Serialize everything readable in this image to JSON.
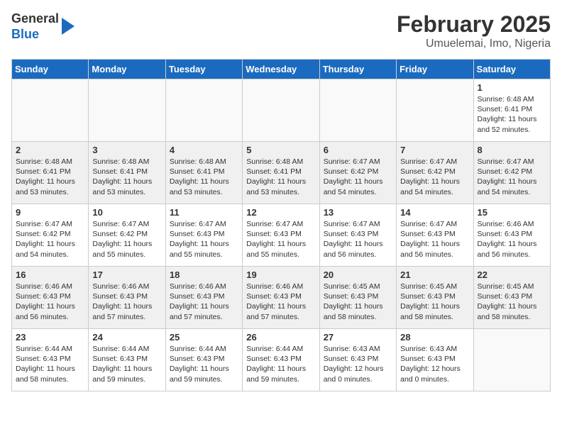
{
  "header": {
    "logo_general": "General",
    "logo_blue": "Blue",
    "title": "February 2025",
    "subtitle": "Umuelemai, Imo, Nigeria"
  },
  "days_of_week": [
    "Sunday",
    "Monday",
    "Tuesday",
    "Wednesday",
    "Thursday",
    "Friday",
    "Saturday"
  ],
  "weeks": [
    [
      {
        "day": "",
        "info": ""
      },
      {
        "day": "",
        "info": ""
      },
      {
        "day": "",
        "info": ""
      },
      {
        "day": "",
        "info": ""
      },
      {
        "day": "",
        "info": ""
      },
      {
        "day": "",
        "info": ""
      },
      {
        "day": "1",
        "info": "Sunrise: 6:48 AM\nSunset: 6:41 PM\nDaylight: 11 hours\nand 52 minutes."
      }
    ],
    [
      {
        "day": "2",
        "info": "Sunrise: 6:48 AM\nSunset: 6:41 PM\nDaylight: 11 hours\nand 53 minutes."
      },
      {
        "day": "3",
        "info": "Sunrise: 6:48 AM\nSunset: 6:41 PM\nDaylight: 11 hours\nand 53 minutes."
      },
      {
        "day": "4",
        "info": "Sunrise: 6:48 AM\nSunset: 6:41 PM\nDaylight: 11 hours\nand 53 minutes."
      },
      {
        "day": "5",
        "info": "Sunrise: 6:48 AM\nSunset: 6:41 PM\nDaylight: 11 hours\nand 53 minutes."
      },
      {
        "day": "6",
        "info": "Sunrise: 6:47 AM\nSunset: 6:42 PM\nDaylight: 11 hours\nand 54 minutes."
      },
      {
        "day": "7",
        "info": "Sunrise: 6:47 AM\nSunset: 6:42 PM\nDaylight: 11 hours\nand 54 minutes."
      },
      {
        "day": "8",
        "info": "Sunrise: 6:47 AM\nSunset: 6:42 PM\nDaylight: 11 hours\nand 54 minutes."
      }
    ],
    [
      {
        "day": "9",
        "info": "Sunrise: 6:47 AM\nSunset: 6:42 PM\nDaylight: 11 hours\nand 54 minutes."
      },
      {
        "day": "10",
        "info": "Sunrise: 6:47 AM\nSunset: 6:42 PM\nDaylight: 11 hours\nand 55 minutes."
      },
      {
        "day": "11",
        "info": "Sunrise: 6:47 AM\nSunset: 6:43 PM\nDaylight: 11 hours\nand 55 minutes."
      },
      {
        "day": "12",
        "info": "Sunrise: 6:47 AM\nSunset: 6:43 PM\nDaylight: 11 hours\nand 55 minutes."
      },
      {
        "day": "13",
        "info": "Sunrise: 6:47 AM\nSunset: 6:43 PM\nDaylight: 11 hours\nand 56 minutes."
      },
      {
        "day": "14",
        "info": "Sunrise: 6:47 AM\nSunset: 6:43 PM\nDaylight: 11 hours\nand 56 minutes."
      },
      {
        "day": "15",
        "info": "Sunrise: 6:46 AM\nSunset: 6:43 PM\nDaylight: 11 hours\nand 56 minutes."
      }
    ],
    [
      {
        "day": "16",
        "info": "Sunrise: 6:46 AM\nSunset: 6:43 PM\nDaylight: 11 hours\nand 56 minutes."
      },
      {
        "day": "17",
        "info": "Sunrise: 6:46 AM\nSunset: 6:43 PM\nDaylight: 11 hours\nand 57 minutes."
      },
      {
        "day": "18",
        "info": "Sunrise: 6:46 AM\nSunset: 6:43 PM\nDaylight: 11 hours\nand 57 minutes."
      },
      {
        "day": "19",
        "info": "Sunrise: 6:46 AM\nSunset: 6:43 PM\nDaylight: 11 hours\nand 57 minutes."
      },
      {
        "day": "20",
        "info": "Sunrise: 6:45 AM\nSunset: 6:43 PM\nDaylight: 11 hours\nand 58 minutes."
      },
      {
        "day": "21",
        "info": "Sunrise: 6:45 AM\nSunset: 6:43 PM\nDaylight: 11 hours\nand 58 minutes."
      },
      {
        "day": "22",
        "info": "Sunrise: 6:45 AM\nSunset: 6:43 PM\nDaylight: 11 hours\nand 58 minutes."
      }
    ],
    [
      {
        "day": "23",
        "info": "Sunrise: 6:44 AM\nSunset: 6:43 PM\nDaylight: 11 hours\nand 58 minutes."
      },
      {
        "day": "24",
        "info": "Sunrise: 6:44 AM\nSunset: 6:43 PM\nDaylight: 11 hours\nand 59 minutes."
      },
      {
        "day": "25",
        "info": "Sunrise: 6:44 AM\nSunset: 6:43 PM\nDaylight: 11 hours\nand 59 minutes."
      },
      {
        "day": "26",
        "info": "Sunrise: 6:44 AM\nSunset: 6:43 PM\nDaylight: 11 hours\nand 59 minutes."
      },
      {
        "day": "27",
        "info": "Sunrise: 6:43 AM\nSunset: 6:43 PM\nDaylight: 12 hours\nand 0 minutes."
      },
      {
        "day": "28",
        "info": "Sunrise: 6:43 AM\nSunset: 6:43 PM\nDaylight: 12 hours\nand 0 minutes."
      },
      {
        "day": "",
        "info": ""
      }
    ]
  ]
}
